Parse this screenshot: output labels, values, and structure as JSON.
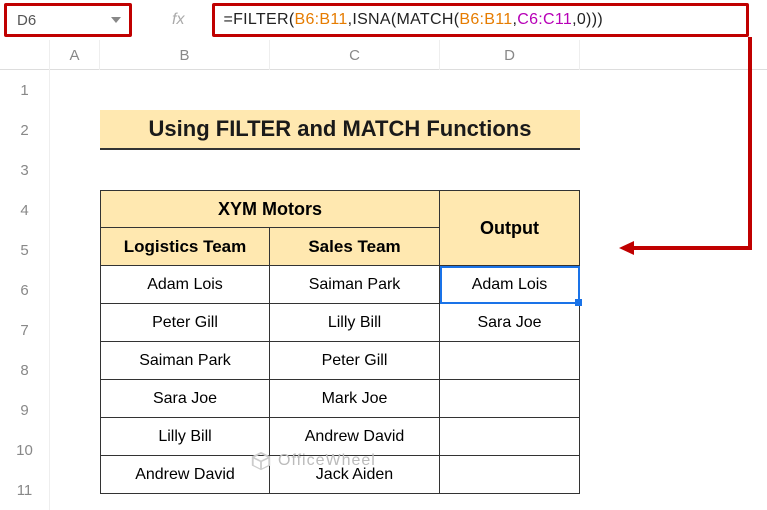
{
  "cell_ref": "D6",
  "fx_label": "fx",
  "formula": {
    "parts": [
      "=FILTER",
      "(",
      "B6:B11",
      ",",
      "ISNA",
      "(",
      "MATCH",
      "(",
      "B6:B11",
      ",",
      "C6:C11",
      ",",
      "0",
      ")",
      ")",
      ")"
    ]
  },
  "columns": [
    "A",
    "B",
    "C",
    "D"
  ],
  "row_numbers": [
    "1",
    "2",
    "3",
    "4",
    "5",
    "6",
    "7",
    "8",
    "9",
    "10",
    "11"
  ],
  "title": "Using FILTER and MATCH Functions",
  "headers": {
    "company": "XYM Motors",
    "logistics": "Logistics Team",
    "sales": "Sales Team",
    "output": "Output"
  },
  "table": {
    "logistics": [
      "Adam Lois",
      "Peter Gill",
      "Saiman Park",
      "Sara Joe",
      "Lilly Bill",
      "Andrew David"
    ],
    "sales": [
      "Saiman Park",
      "Lilly Bill",
      "Peter Gill",
      "Mark Joe",
      "Andrew David",
      "Jack Aiden"
    ],
    "output": [
      "Adam Lois",
      "Sara Joe",
      "",
      "",
      "",
      ""
    ]
  },
  "watermark": "OfficeWheel",
  "chart_data": {
    "type": "table",
    "title": "Using FILTER and MATCH Functions",
    "subtitle": "XYM Motors",
    "columns": [
      "Logistics Team",
      "Sales Team",
      "Output"
    ],
    "rows": [
      [
        "Adam Lois",
        "Saiman Park",
        "Adam Lois"
      ],
      [
        "Peter Gill",
        "Lilly Bill",
        "Sara Joe"
      ],
      [
        "Saiman Park",
        "Peter Gill",
        ""
      ],
      [
        "Sara Joe",
        "Mark Joe",
        ""
      ],
      [
        "Lilly Bill",
        "Andrew David",
        ""
      ],
      [
        "Andrew David",
        "Jack Aiden",
        ""
      ]
    ]
  }
}
